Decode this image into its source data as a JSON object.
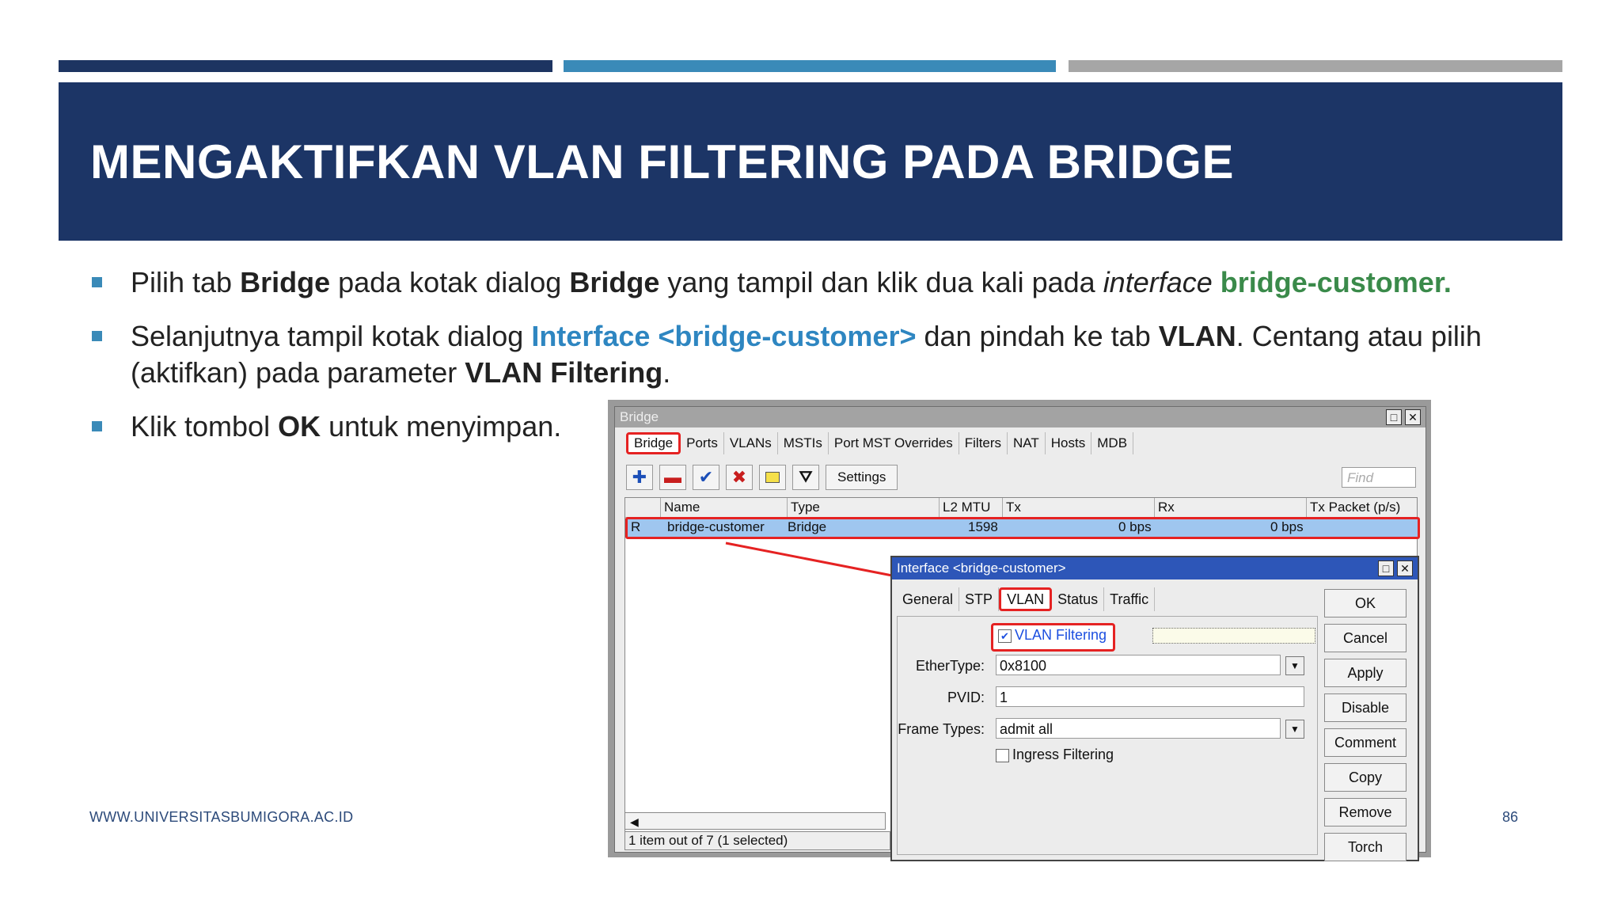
{
  "slide": {
    "title": "MENGAKTIFKAN VLAN FILTERING PADA BRIDGE",
    "bullets": [
      {
        "p1": "Pilih tab ",
        "b1": "Bridge",
        "p2": " pada kotak dialog ",
        "b2": "Bridge",
        "p3": " yang tampil dan klik dua kali pada ",
        "i1": "interface",
        "p4": " ",
        "g1": "bridge-customer."
      },
      {
        "p1": "Selanjutnya tampil kotak dialog ",
        "c1": "Interface <bridge-customer>",
        "p2": " dan pindah ke tab ",
        "b1": "VLAN",
        "p3": ". Centang atau pilih (aktifkan) pada parameter ",
        "b2": "VLAN Filtering",
        "p4": "."
      },
      {
        "p1": "Klik tombol ",
        "b1": "OK",
        "p2": " untuk menyimpan."
      }
    ],
    "footer_url": "WWW.UNIVERSITASBUMIGORA.AC.ID",
    "page_number": "86",
    "colors": {
      "title_bg": "#1c3566",
      "bullet": "#3a8ab8",
      "green": "#3a8a4a",
      "blue": "#2e86c1",
      "highlight": "#e52222"
    }
  },
  "bridge_window": {
    "title": "Bridge",
    "tabs": [
      "Bridge",
      "Ports",
      "VLANs",
      "MSTIs",
      "Port MST Overrides",
      "Filters",
      "NAT",
      "Hosts",
      "MDB"
    ],
    "toolbar": {
      "settings_label": "Settings",
      "find_placeholder": "Find",
      "icons": [
        "plus-icon",
        "minus-icon",
        "check-icon",
        "cross-icon",
        "comment-icon",
        "filter-icon"
      ]
    },
    "columns": [
      "Name",
      "Type",
      "L2 MTU",
      "Tx",
      "Rx",
      "Tx Packet (p/s)"
    ],
    "row": {
      "flag": "R",
      "name": "bridge-customer",
      "type": "Bridge",
      "l2mtu": "1598",
      "tx": "0 bps",
      "rx": "0 bps"
    },
    "status": "1 item out of 7 (1 selected)"
  },
  "interface_dialog": {
    "title": "Interface <bridge-customer>",
    "tabs": [
      "General",
      "STP",
      "VLAN",
      "Status",
      "Traffic"
    ],
    "vlan_filtering": {
      "label": "VLAN Filtering",
      "checked": true
    },
    "ethertype": {
      "label": "EtherType:",
      "value": "0x8100"
    },
    "pvid": {
      "label": "PVID:",
      "value": "1"
    },
    "frame_types": {
      "label": "Frame Types:",
      "value": "admit all"
    },
    "ingress_filtering": {
      "label": "Ingress Filtering",
      "checked": false
    },
    "buttons": [
      "OK",
      "Cancel",
      "Apply",
      "Disable",
      "Comment",
      "Copy",
      "Remove",
      "Torch"
    ]
  }
}
